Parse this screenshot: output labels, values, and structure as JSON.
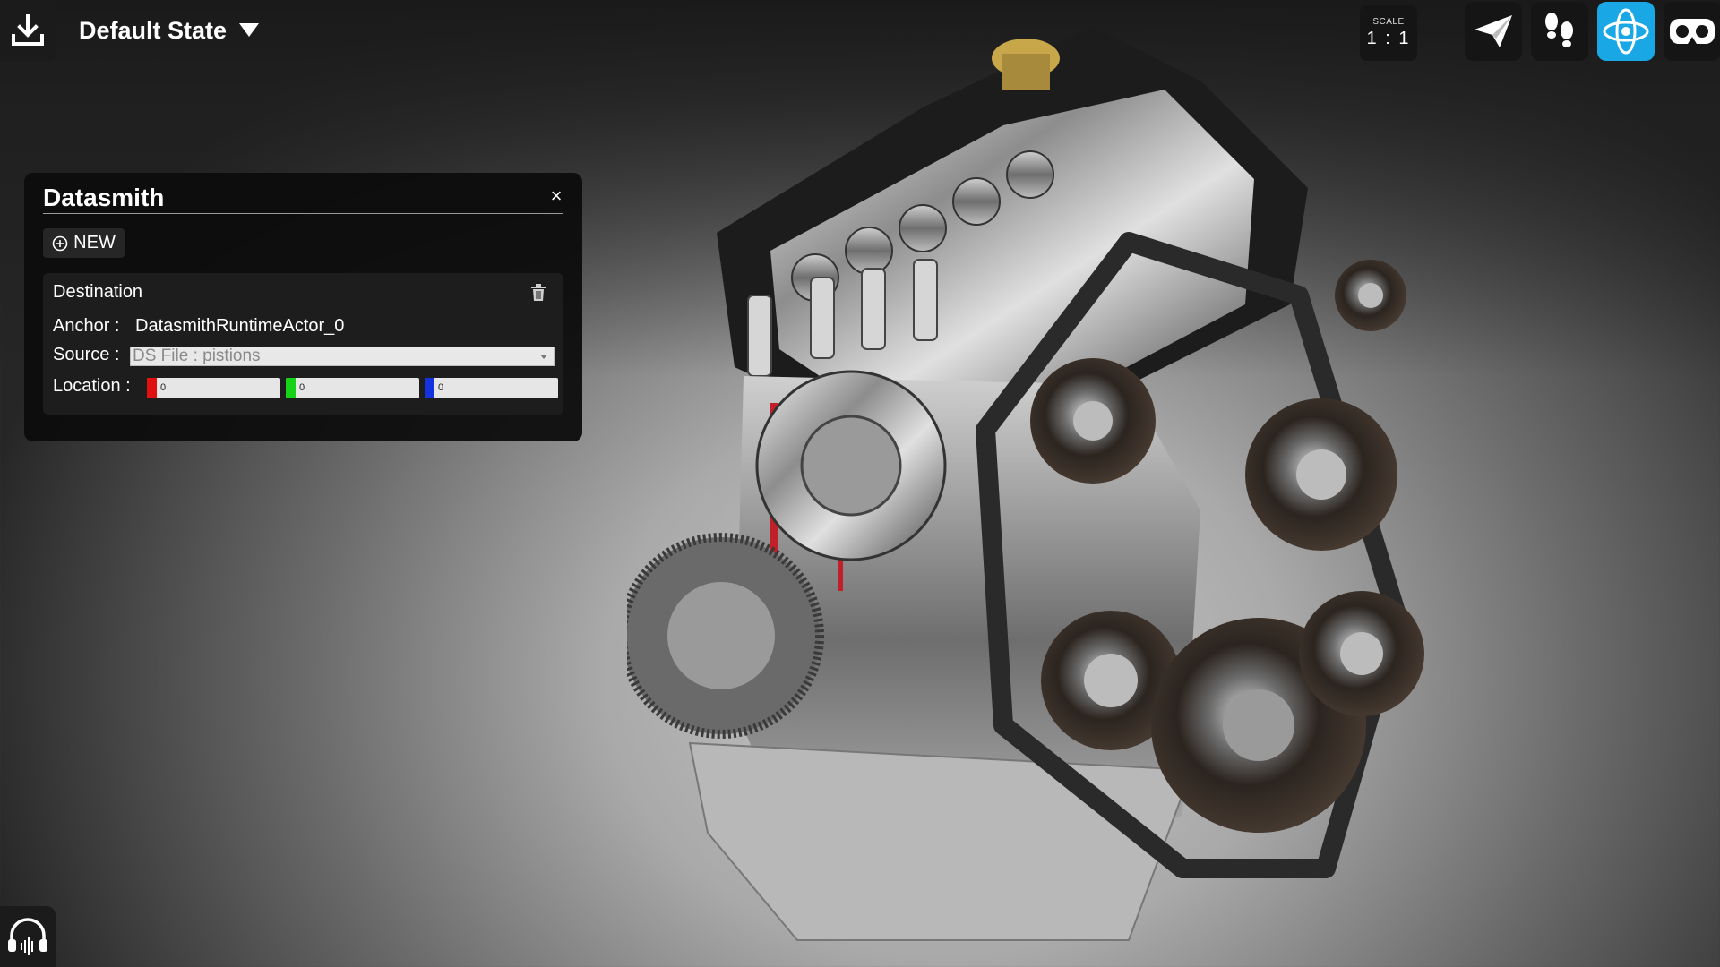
{
  "header": {
    "state_label": "Default State"
  },
  "scale": {
    "label": "SCALE",
    "value": "1 : 1"
  },
  "modes": [
    {
      "name": "fly",
      "icon": "paper-plane-icon",
      "active": false
    },
    {
      "name": "walk",
      "icon": "footsteps-icon",
      "active": false
    },
    {
      "name": "orbit",
      "icon": "orbit-icon",
      "active": true
    },
    {
      "name": "vr",
      "icon": "vr-headset-icon",
      "active": false
    }
  ],
  "panel": {
    "title": "Datasmith",
    "close_glyph": "×",
    "new_label": "NEW",
    "destination": {
      "title": "Destination",
      "anchor_label": "Anchor :",
      "anchor_value": "DatasmithRuntimeActor_0",
      "source_label": "Source :",
      "source_value": "DS File : pistions",
      "location_label": "Location :",
      "location": {
        "x": "0",
        "y": "0",
        "z": "0"
      }
    }
  },
  "colors": {
    "accent": "#1aa7e6",
    "axis_x": "#e01010",
    "axis_y": "#17d317",
    "axis_z": "#1432e0"
  }
}
